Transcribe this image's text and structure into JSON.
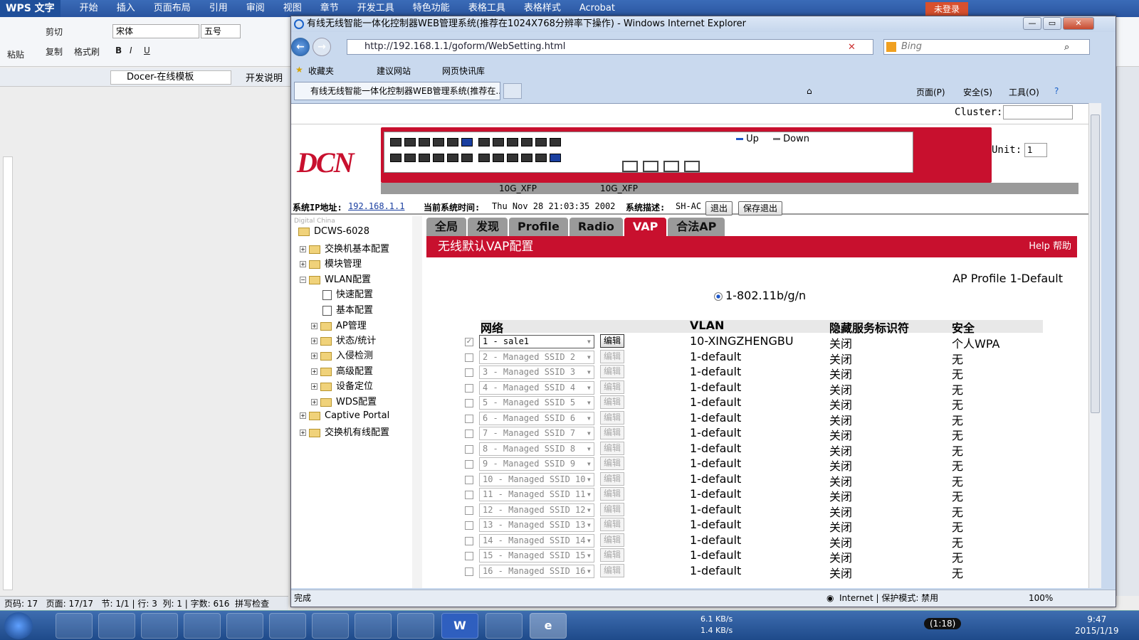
{
  "wps": {
    "app_name": "WPS 文字",
    "tabs": [
      "开始",
      "插入",
      "页面布局",
      "引用",
      "审阅",
      "视图",
      "章节",
      "开发工具",
      "特色功能",
      "表格工具",
      "表格样式",
      "Acrobat"
    ],
    "login": "未登录",
    "paste": "粘贴",
    "cut": "剪切",
    "copy": "复制",
    "format_painter": "格式刷",
    "font": "宋体",
    "font_size": "五号",
    "doc_tab": "Docer-在线模板",
    "doc_tab2": "开发说明",
    "status": {
      "page": "页码: 17",
      "pages": "页面: 17/17",
      "section": "节: 1/1",
      "row": "行: 3",
      "col": "列: 1",
      "words": "字数: 616",
      "spell": "拼写检查"
    }
  },
  "ie": {
    "title": "有线无线智能一体化控制器WEB管理系统(推荐在1024X768分辨率下操作) - Windows Internet Explorer",
    "url": "http://192.168.1.1/goform/WebSetting.html",
    "search_placeholder": "Bing",
    "favorites": "收藏夹",
    "suggested_sites": "建议网站",
    "web_slice": "网页快讯库",
    "tab_title": "有线无线智能一体化控制器WEB管理系统(推荐在...",
    "page_menu": "页面(P)",
    "safety_menu": "安全(S)",
    "tools_menu": "工具(O)",
    "status_done": "完成",
    "status_zone": "Internet | 保护模式: 禁用",
    "zoom": "100%"
  },
  "device": {
    "cluster_label": "Cluster:",
    "logo": "DCN",
    "legend_up": "Up",
    "legend_down": "Down",
    "xfp1": "10G_XFP",
    "xfp2": "10G_XFP",
    "unit_label": "Unit:",
    "unit_value": "1",
    "ip_label": "系统IP地址:",
    "ip_value": "192.168.1.1",
    "time_label": "当前系统时间:",
    "time_value": "Thu Nov 28 21:03:35 2002",
    "desc_label": "系统描述:",
    "desc_value": "SH-AC",
    "logout": "退出",
    "save_exit": "保存退出"
  },
  "tree": {
    "brand": "Digital China",
    "root": "DCWS-6028",
    "items": [
      "交换机基本配置",
      "模块管理",
      "WLAN配置",
      "快速配置",
      "基本配置",
      "AP管理",
      "状态/统计",
      "入侵检测",
      "高级配置",
      "设备定位",
      "WDS配置",
      "Captive Portal",
      "交换机有线配置"
    ]
  },
  "main": {
    "tabs": [
      "全局",
      "发现",
      "Profile",
      "Radio",
      "VAP",
      "合法AP"
    ],
    "title": "无线默认VAP配置",
    "help": "Help 帮助",
    "ap_profile": "AP Profile 1-Default",
    "radio": "1-802.11b/g/n",
    "headers": {
      "network": "网络",
      "vlan": "VLAN",
      "hidden": "隐藏服务标识符",
      "security": "安全"
    },
    "edit_label": "编辑",
    "rows": [
      {
        "net": "1 - sale1",
        "vlan": "10-XINGZHENGBU",
        "hidden": "关闭",
        "sec": "个人WPA",
        "checked": true
      },
      {
        "net": "2 - Managed SSID 2",
        "vlan": "1-default",
        "hidden": "关闭",
        "sec": "无",
        "checked": false
      },
      {
        "net": "3 - Managed SSID 3",
        "vlan": "1-default",
        "hidden": "关闭",
        "sec": "无",
        "checked": false
      },
      {
        "net": "4 - Managed SSID 4",
        "vlan": "1-default",
        "hidden": "关闭",
        "sec": "无",
        "checked": false
      },
      {
        "net": "5 - Managed SSID 5",
        "vlan": "1-default",
        "hidden": "关闭",
        "sec": "无",
        "checked": false
      },
      {
        "net": "6 - Managed SSID 6",
        "vlan": "1-default",
        "hidden": "关闭",
        "sec": "无",
        "checked": false
      },
      {
        "net": "7 - Managed SSID 7",
        "vlan": "1-default",
        "hidden": "关闭",
        "sec": "无",
        "checked": false
      },
      {
        "net": "8 - Managed SSID 8",
        "vlan": "1-default",
        "hidden": "关闭",
        "sec": "无",
        "checked": false
      },
      {
        "net": "9 - Managed SSID 9",
        "vlan": "1-default",
        "hidden": "关闭",
        "sec": "无",
        "checked": false
      },
      {
        "net": "10 - Managed SSID 10",
        "vlan": "1-default",
        "hidden": "关闭",
        "sec": "无",
        "checked": false
      },
      {
        "net": "11 - Managed SSID 11",
        "vlan": "1-default",
        "hidden": "关闭",
        "sec": "无",
        "checked": false
      },
      {
        "net": "12 - Managed SSID 12",
        "vlan": "1-default",
        "hidden": "关闭",
        "sec": "无",
        "checked": false
      },
      {
        "net": "13 - Managed SSID 13",
        "vlan": "1-default",
        "hidden": "关闭",
        "sec": "无",
        "checked": false
      },
      {
        "net": "14 - Managed SSID 14",
        "vlan": "1-default",
        "hidden": "关闭",
        "sec": "无",
        "checked": false
      },
      {
        "net": "15 - Managed SSID 15",
        "vlan": "1-default",
        "hidden": "关闭",
        "sec": "无",
        "checked": false
      },
      {
        "net": "16 - Managed SSID 16",
        "vlan": "1-default",
        "hidden": "关闭",
        "sec": "无",
        "checked": false
      }
    ]
  },
  "taskbar": {
    "net_down": "6.1 KB/s",
    "net_up": "1.4 KB/s",
    "battery": "(1:18)",
    "time": "9:47",
    "date": "2015/1/19"
  },
  "colors": {
    "accent_red": "#c8102e",
    "port_up": "#1a3fa0"
  }
}
